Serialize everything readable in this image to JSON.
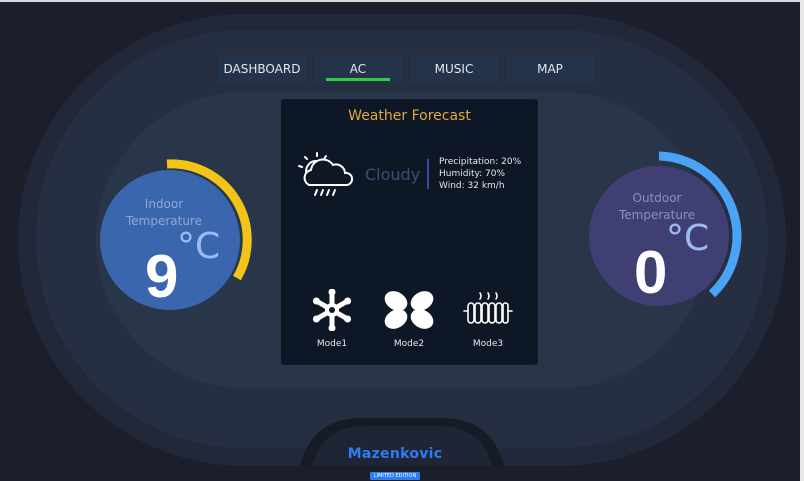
{
  "nav": {
    "tabs": [
      {
        "label": "DASHBOARD",
        "active": false
      },
      {
        "label": "AC",
        "active": true
      },
      {
        "label": "MUSIC",
        "active": false
      },
      {
        "label": "MAP",
        "active": false
      }
    ]
  },
  "weather": {
    "title": "Weather Forecast",
    "icon": "cloudy-sun-rain-icon",
    "condition": "Cloudy",
    "precipitation": "Precipitation: 20%",
    "humidity": "Humidity: 70%",
    "wind": "Wind: 32 km/h"
  },
  "modes": [
    {
      "label": "Mode1",
      "icon": "snowflake-icon"
    },
    {
      "label": "Mode2",
      "icon": "fan-icon"
    },
    {
      "label": "Mode3",
      "icon": "heater-icon"
    }
  ],
  "indoor": {
    "title_line1": "Indoor",
    "title_line2": "Temperature",
    "unit": "°C",
    "value": "9",
    "arc_fraction": 0.45,
    "arc_color": "#f2c417",
    "face_color": "#3a66ad"
  },
  "outdoor": {
    "title_line1": "Outdoor",
    "title_line2": "Temperature",
    "unit": "°C",
    "value": "0",
    "arc_fraction": 0.45,
    "arc_color": "#4aa3f5",
    "face_color": "#403f73"
  },
  "brand": {
    "name": "Mazenkovic",
    "badge": "LIMITED EDITION"
  },
  "colors": {
    "background": "#1b1f2b",
    "accent_active_tab": "#2ecc40",
    "panel_title": "#e0a93a",
    "brand": "#2f7df4"
  }
}
